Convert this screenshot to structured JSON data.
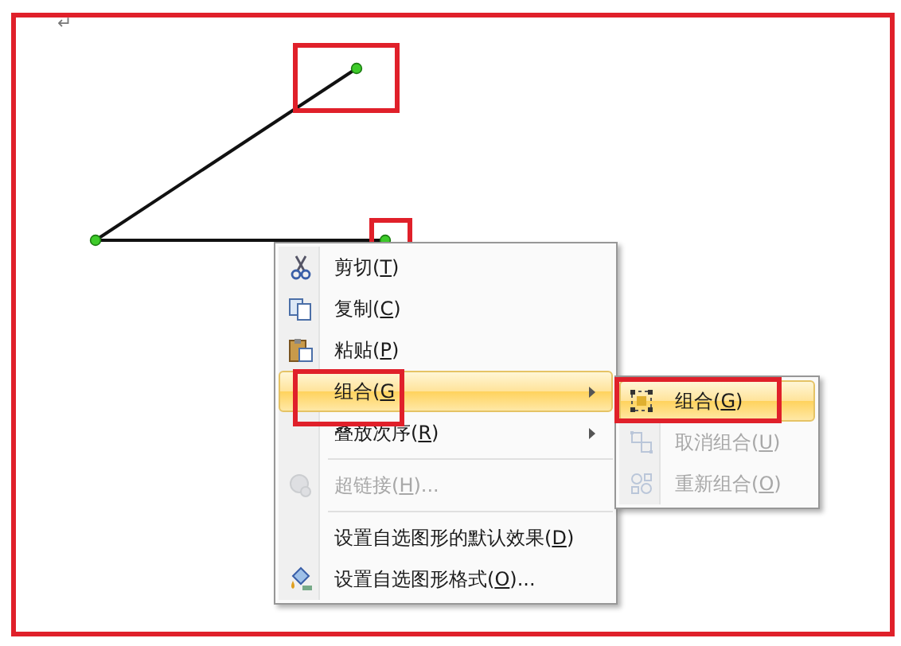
{
  "document": {
    "paragraph_mark": "↵"
  },
  "context_menu": {
    "items": [
      {
        "kind": "command",
        "label": "剪切(T)",
        "selected": false,
        "disabled": false
      },
      {
        "kind": "command",
        "label": "复制(C)",
        "selected": false,
        "disabled": false
      },
      {
        "kind": "command",
        "label": "粘贴(P)",
        "selected": false,
        "disabled": false
      },
      {
        "kind": "submenu",
        "label": "组合(G",
        "selected": true,
        "disabled": false
      },
      {
        "kind": "submenu",
        "label": "叠放次序(R)",
        "selected": false,
        "disabled": false
      },
      {
        "kind": "separator"
      },
      {
        "kind": "command",
        "label": "超链接(H)...",
        "selected": false,
        "disabled": true
      },
      {
        "kind": "separator"
      },
      {
        "kind": "command",
        "label": "设置自选图形的默认效果(D)",
        "selected": false,
        "disabled": false
      },
      {
        "kind": "command",
        "label": "设置自选图形格式(O)...",
        "selected": false,
        "disabled": false
      }
    ]
  },
  "submenu": {
    "items": [
      {
        "kind": "command",
        "label": "组合(G)",
        "selected": true,
        "disabled": false
      },
      {
        "kind": "command",
        "label": "取消组合(U)",
        "selected": false,
        "disabled": true
      },
      {
        "kind": "command",
        "label": "重新组合(O)",
        "selected": false,
        "disabled": true
      }
    ]
  }
}
